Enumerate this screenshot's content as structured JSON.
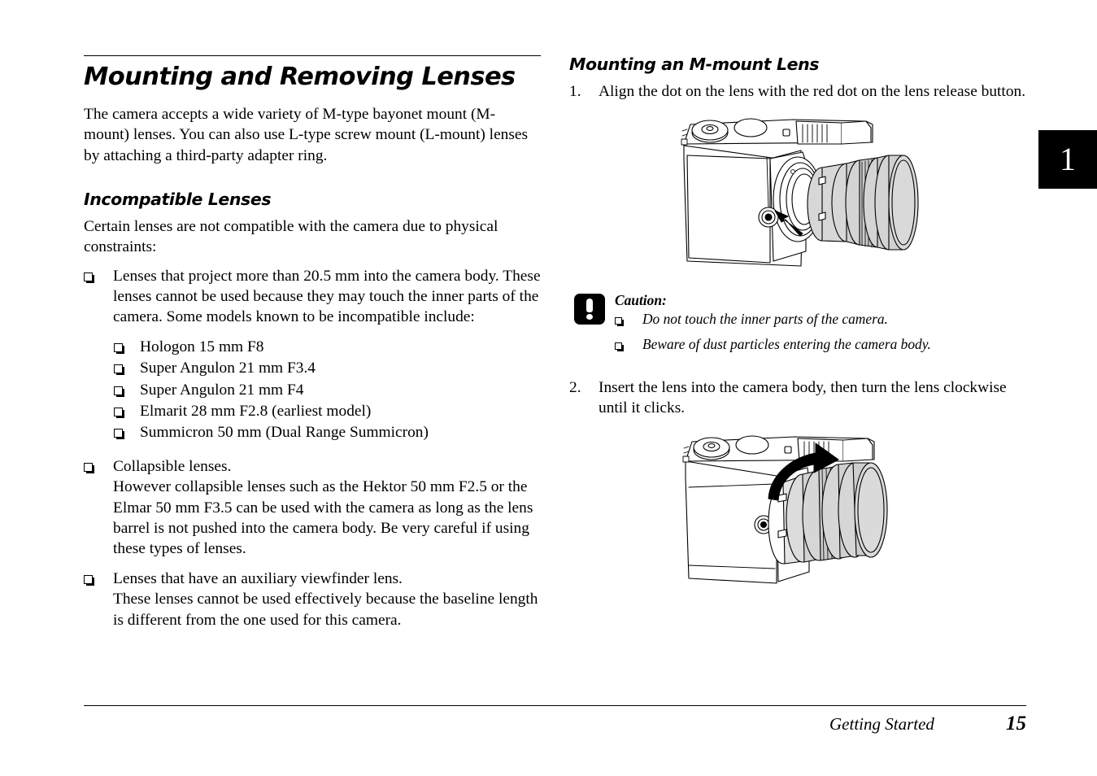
{
  "page": {
    "chapter_tab": "1",
    "footer_chapter": "Getting Started",
    "footer_page_number": "15",
    "background_color": "#ffffff",
    "text_color": "#000000"
  },
  "left_column": {
    "title": "Mounting and Removing Lenses",
    "intro": "The camera accepts a wide variety of M-type bayonet mount (M-mount) lenses. You can also use L-type screw mount (L-mount) lenses by attaching a third-party adapter ring.",
    "section": {
      "heading": "Incompatible Lenses",
      "lead": "Certain lenses are not compatible with the camera due to physical constraints:",
      "bullets": [
        {
          "text": "Lenses that project more than 20.5 mm into the camera body. These lenses cannot be used because they may touch the inner parts of the camera. Some models known to be incompatible include:",
          "sub_bullets": [
            "Hologon 15 mm F8",
            "Super Angulon 21 mm F3.4",
            "Super Angulon 21 mm F4",
            "Elmarit 28 mm F2.8 (earliest model)",
            "Summicron 50 mm (Dual Range Summicron)"
          ]
        },
        {
          "text": "Collapsible lenses.\nHowever collapsible lenses such as the Hektor 50 mm F2.5 or the Elmar 50 mm F3.5 can be used with the camera as long as the lens barrel is not pushed into the camera body. Be very careful if using these types of lenses.",
          "sub_bullets": []
        },
        {
          "text": "Lenses that have an auxiliary viewfinder lens.\nThese lenses cannot be used effectively because the baseline length is different from the one used for this camera.",
          "sub_bullets": []
        }
      ]
    }
  },
  "right_column": {
    "heading": "Mounting an M-mount Lens",
    "steps": [
      {
        "number": "1.",
        "text": "Align the dot on the lens with the red dot on the lens release button."
      },
      {
        "number": "2.",
        "text": "Insert the lens into the camera body, then turn the lens clockwise until it clicks."
      }
    ],
    "caution": {
      "icon": "exclamation-icon",
      "title": "Caution:",
      "items": [
        "Do not touch the inner parts of the camera.",
        "Beware of dust particles entering the camera body."
      ]
    },
    "figures": [
      {
        "name": "camera-lens-align-illustration",
        "alt": "Line drawing of a rangefinder camera body with the lens held away from the bayonet mount and a straight arrow pointing toward the red dot on the lens release button"
      },
      {
        "name": "camera-lens-rotate-illustration",
        "alt": "Line drawing of a rangefinder camera with the lens inserted in the mount and a curved arrow indicating clockwise rotation"
      }
    ]
  },
  "bullet_glyph": "shadowed-open-square"
}
